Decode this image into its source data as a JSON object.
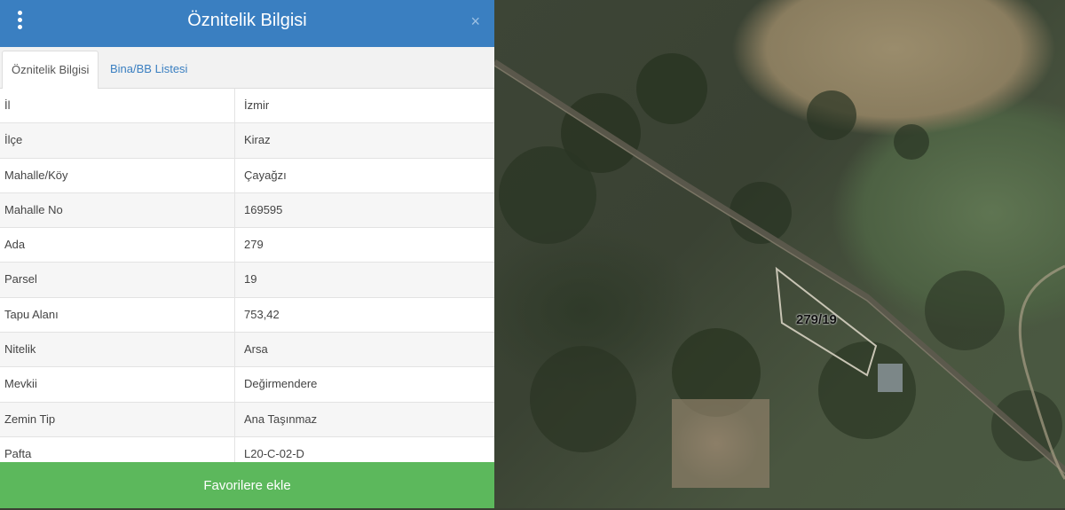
{
  "panel": {
    "title": "Öznitelik Bilgisi",
    "tabs": [
      {
        "label": "Öznitelik Bilgisi",
        "active": true
      },
      {
        "label": "Bina/BB Listesi",
        "active": false
      }
    ],
    "rows": [
      {
        "key": "İl",
        "value": "İzmir"
      },
      {
        "key": "İlçe",
        "value": "Kiraz"
      },
      {
        "key": "Mahalle/Köy",
        "value": "Çayağzı"
      },
      {
        "key": "Mahalle No",
        "value": "169595"
      },
      {
        "key": "Ada",
        "value": "279"
      },
      {
        "key": "Parsel",
        "value": "19"
      },
      {
        "key": "Tapu Alanı",
        "value": "753,42"
      },
      {
        "key": "Nitelik",
        "value": "Arsa"
      },
      {
        "key": "Mevkii",
        "value": "Değirmendere"
      },
      {
        "key": "Zemin Tip",
        "value": "Ana Taşınmaz"
      },
      {
        "key": "Pafta",
        "value": "L20-C-02-D"
      }
    ],
    "favorite_button": "Favorilere ekle",
    "icons": {
      "menu": "vertical-ellipsis-icon",
      "close": "close-icon"
    }
  },
  "map": {
    "parcel_label": "279/19"
  },
  "colors": {
    "header": "#3a7fc1",
    "favorite": "#5cb85c"
  }
}
